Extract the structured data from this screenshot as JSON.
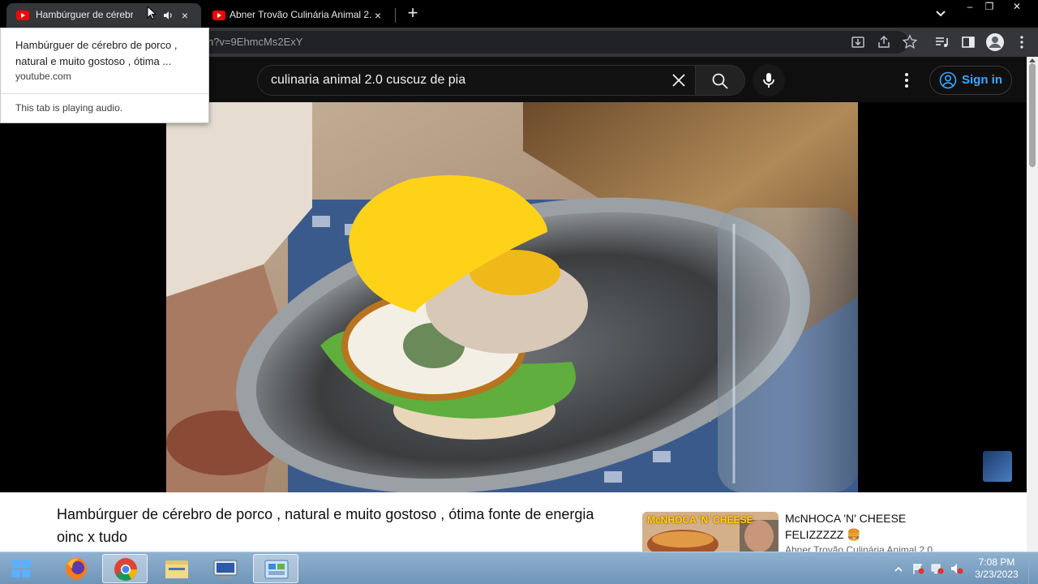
{
  "browser": {
    "tabs": [
      {
        "label": "Hambúrguer de cérebro de porco , natural e muito gostoso",
        "active": true,
        "playing_audio": true
      },
      {
        "label": "Abner Trovão Culinária Animal 2.0",
        "active": false
      }
    ],
    "new_tab_symbol": "+",
    "close_symbol": "×",
    "url": "n?v=9EhmcMs2ExY",
    "window_controls": {
      "minimize": "–",
      "restore": "❐",
      "close": "✕"
    }
  },
  "hovercard": {
    "title": "Hambúrguer de cérebro de porco , natural e muito gostoso , ótima ...",
    "domain": "youtube.com",
    "audio_status": "This tab is playing audio."
  },
  "youtube": {
    "search_value": "culinaria animal 2.0 cuscuz de pia",
    "sign_in": "Sign in",
    "video_title": "Hambúrguer de cérebro de porco , natural e muito gostoso , ótima fonte de energia oinc x tudo",
    "recommended": {
      "thumb_text": "McNHOCA 'N' CHEESE",
      "title": "McNHOCA 'N' CHEESE FELIZZZZZ 🍔",
      "channel": "Abner Trovão Culinária Animal 2.0"
    }
  },
  "taskbar": {
    "time": "7:08 PM",
    "date": "3/23/2023",
    "apps": [
      "firefox-icon",
      "chrome-icon",
      "file-explorer-icon",
      "network-app-icon",
      "control-panel-icon"
    ]
  },
  "colors": {
    "yt_red": "#ff0000",
    "signin_blue": "#3ea6ff",
    "chrome_dark": "#35363a",
    "yt_dark": "#0f0f0f"
  }
}
